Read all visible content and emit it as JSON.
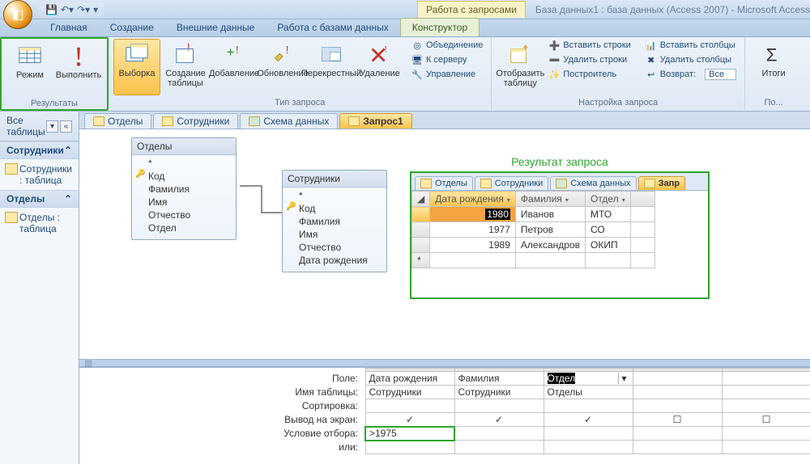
{
  "title": {
    "context": "Работа с запросами",
    "doc": "База данных1 : база данных (Access 2007) - Microsoft Access"
  },
  "tabs": {
    "t1": "Главная",
    "t2": "Создание",
    "t3": "Внешние данные",
    "t4": "Работа с базами данных",
    "t5": "Конструктор"
  },
  "ribbon": {
    "results_cap": "Результаты",
    "mode": "Режим",
    "run": "Выполнить",
    "querytype_cap": "Тип запроса",
    "sel": "Выборка",
    "mktbl": "Создание таблицы",
    "append": "Добавление",
    "update": "Обновление",
    "cross": "Перекрестный",
    "delete": "Удаление",
    "union": "Объединение",
    "toserver": "К серверу",
    "manage": "Управление",
    "showtable": "Отобразить таблицу",
    "insert_rows": "Вставить строки",
    "delete_rows": "Удалить строки",
    "builder": "Построитель",
    "insert_cols": "Вставить столбцы",
    "delete_cols": "Удалить столбцы",
    "return_lbl": "Возврат:",
    "return_val": "Все",
    "setup_cap": "Настройка запроса",
    "totals": "Итоги",
    "extras_cap": "По..."
  },
  "sidebar": {
    "head": "Все таблицы",
    "cat1": "Сотрудники",
    "item1": "Сотрудники : таблица",
    "cat2": "Отделы",
    "item2": "Отделы : таблица"
  },
  "worktabs": {
    "t1": "Отделы",
    "t2": "Сотрудники",
    "t3": "Схема данных",
    "t4": "Запрос1"
  },
  "tbl_otdely": {
    "name": "Отделы",
    "star": "*",
    "f1": "Код",
    "f2": "Фамилия",
    "f3": "Имя",
    "f4": "Отчество",
    "f5": "Отдел"
  },
  "tbl_sotr": {
    "name": "Сотрудники",
    "star": "*",
    "f1": "Код",
    "f2": "Фамилия",
    "f3": "Имя",
    "f4": "Отчество",
    "f5": "Дата рождения"
  },
  "result": {
    "title": "Результат запроса",
    "tabs": {
      "t1": "Отделы",
      "t2": "Сотрудники",
      "t3": "Схема данных",
      "t4": "Запр"
    },
    "cols": {
      "c1": "Дата рождения",
      "c2": "Фамилия",
      "c3": "Отдел"
    },
    "rows": [
      {
        "birth": "1980",
        "fam": "Иванов",
        "dept": "МТО"
      },
      {
        "birth": "1977",
        "fam": "Петров",
        "dept": "СО"
      },
      {
        "birth": "1989",
        "fam": "Александров",
        "dept": "ОКИП"
      }
    ]
  },
  "design": {
    "labels": {
      "field": "Поле:",
      "table": "Имя таблицы:",
      "sort": "Сортировка:",
      "show": "Вывод на экран:",
      "crit": "Условие отбора:",
      "or": "или:"
    },
    "c1": {
      "field": "Дата рождения",
      "table": "Сотрудники",
      "crit": ">1975"
    },
    "c2": {
      "field": "Фамилия",
      "table": "Сотрудники"
    },
    "c3": {
      "field": "Отдел",
      "table": "Отделы"
    },
    "chk": "✓"
  },
  "chart_data": {
    "type": "table",
    "title": "Результат запроса",
    "columns": [
      "Дата рождения",
      "Фамилия",
      "Отдел"
    ],
    "rows": [
      [
        1980,
        "Иванов",
        "МТО"
      ],
      [
        1977,
        "Петров",
        "СО"
      ],
      [
        1989,
        "Александров",
        "ОКИП"
      ]
    ]
  }
}
